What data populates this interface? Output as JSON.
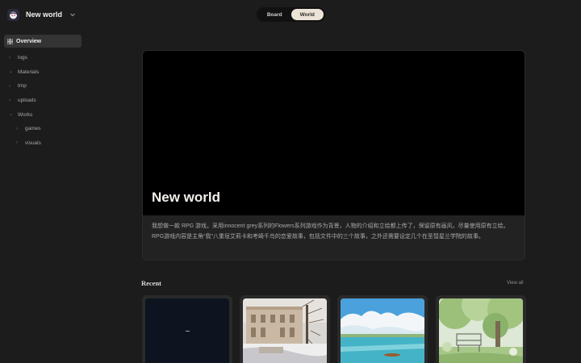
{
  "brand": {
    "title": "New world",
    "logo_icon": "mascot-icon",
    "caret_icon": "chevron-down-icon"
  },
  "view_toggle": {
    "options": [
      "Board",
      "World"
    ],
    "selected": "World"
  },
  "sidebar": {
    "active": {
      "label": "Overview",
      "icon": "grid-icon"
    },
    "items": [
      {
        "label": "logs",
        "indent": 0,
        "icon": "chevron-right-icon"
      },
      {
        "label": "Materials",
        "indent": 0,
        "icon": "chevron-down-icon"
      },
      {
        "label": "tmp",
        "indent": 0,
        "icon": "chevron-right-icon"
      },
      {
        "label": "uploads",
        "indent": 0,
        "icon": "chevron-right-icon"
      },
      {
        "label": "Works",
        "indent": 0,
        "icon": "chevron-down-icon"
      },
      {
        "label": "games",
        "indent": 1,
        "icon": "chevron-right-icon"
      },
      {
        "label": "visuals",
        "indent": 1,
        "icon": "chevron-right-icon"
      }
    ]
  },
  "hero": {
    "title": "New world",
    "description": "我想做一款 RPG 游戏，采用innocent grey系列的Flowers系列游戏作为背景，人物的介绍和立绘都上传了，保留原有画风，尽量使用原有立绘。RPG游戏内容是主角“我”八重垣艾莉卡和考崎千鸟的恋爱故事，包括文件中的三个故事，之外还需要设定几个在圣彗星兰学院的故事。"
  },
  "recent": {
    "title": "Recent",
    "view_all": "View all",
    "cards": [
      {
        "name": "dark-scene-thumbnail"
      },
      {
        "name": "snowy-building-thumbnail"
      },
      {
        "name": "lake-sky-thumbnail"
      },
      {
        "name": "garden-bench-thumbnail"
      }
    ]
  },
  "colors": {
    "background": "#1c1c1c",
    "toggle_active": "#ece4d6",
    "sidebar_active": "#343434"
  }
}
